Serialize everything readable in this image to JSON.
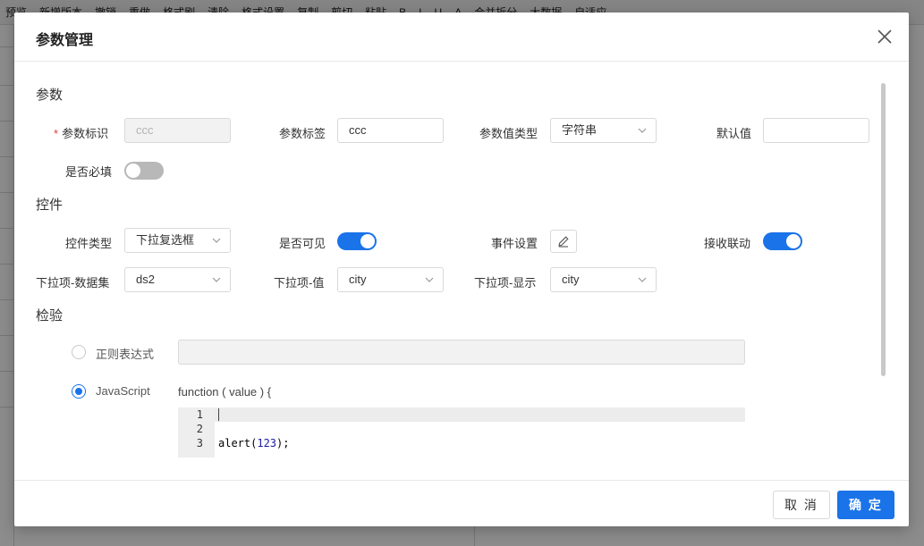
{
  "background": {
    "toolbar_items": [
      "预览",
      "新增版本",
      "撤销",
      "重做",
      "格式刷",
      "清除",
      "格式设置",
      "复制",
      "剪切",
      "粘贴",
      "B",
      "I",
      "U",
      "A",
      "合并拆分",
      "大数据",
      "自适应"
    ]
  },
  "dialog": {
    "title": "参数管理",
    "sections": {
      "param": "参数",
      "control": "控件",
      "validation": "检验"
    },
    "param": {
      "id_label": "参数标识",
      "id_value": "ccc",
      "tag_label": "参数标签",
      "tag_value": "ccc",
      "type_label": "参数值类型",
      "type_value": "字符串",
      "default_label": "默认值",
      "default_value": "",
      "required_label": "是否必填",
      "required": false
    },
    "control": {
      "type_label": "控件类型",
      "type_value": "下拉复选框",
      "visible_label": "是否可见",
      "visible": true,
      "event_label": "事件设置",
      "linkage_label": "接收联动",
      "linkage": true,
      "dataset_label": "下拉项-数据集",
      "dataset_value": "ds2",
      "value_label": "下拉项-值",
      "value_value": "city",
      "display_label": "下拉项-显示",
      "display_value": "city"
    },
    "validation": {
      "regex_label": "正则表达式",
      "regex_checked": false,
      "js_label": "JavaScript",
      "js_checked": true,
      "func_signature": "function ( value ) {",
      "line_numbers": [
        "1",
        "2",
        "3"
      ],
      "code_line3_prefix": "alert(",
      "code_line3_num": "123",
      "code_line3_suffix": ");"
    },
    "footer": {
      "cancel_label": "取 消",
      "ok_label": "确 定"
    }
  },
  "colors": {
    "accent": "#1a73e8",
    "required": "#e03b3b"
  }
}
